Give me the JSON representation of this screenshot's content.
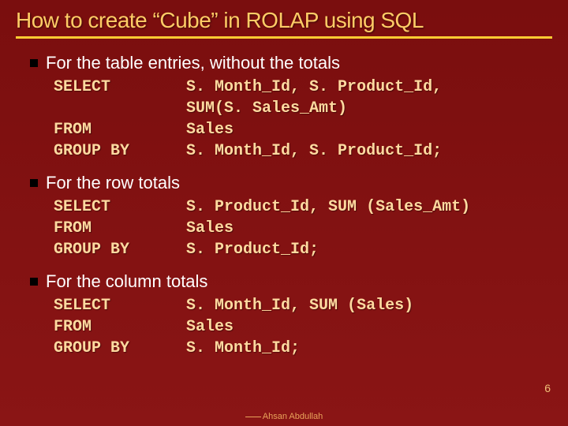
{
  "title": "How to create “Cube” in ROLAP using SQL",
  "sections": [
    {
      "heading": "For the table entries, without the totals",
      "code": "SELECT        S. Month_Id, S. Product_Id,\n              SUM(S. Sales_Amt)\nFROM          Sales\nGROUP BY      S. Month_Id, S. Product_Id;"
    },
    {
      "heading": "For the row totals",
      "code": "SELECT        S. Product_Id, SUM (Sales_Amt)\nFROM          Sales\nGROUP BY      S. Product_Id;"
    },
    {
      "heading": "For the column totals",
      "code": "SELECT        S. Month_Id, SUM (Sales)\nFROM          Sales\nGROUP BY      S. Month_Id;"
    }
  ],
  "author": "Ahsan Abdullah",
  "page_number": "6"
}
